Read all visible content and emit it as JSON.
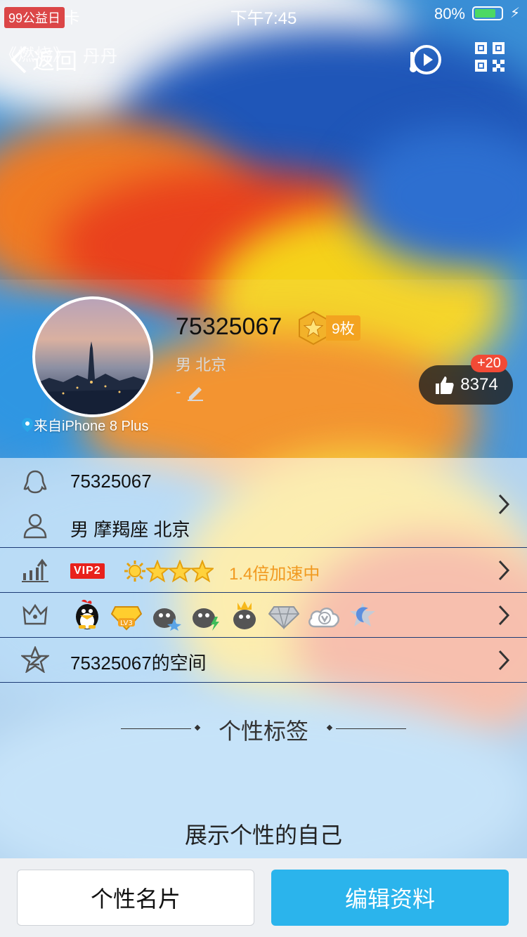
{
  "status_bar": {
    "carrier": "无 SIM 卡",
    "watermark": "99公益日",
    "time": "下午7:45",
    "battery_percent": "80%",
    "battery_level": 0.8
  },
  "nav": {
    "back_label": "返回",
    "song_left": "《燃烧》",
    "song_right": "丹丹",
    "music_icon": "music-play-icon",
    "qr_icon": "qr-code-icon"
  },
  "profile": {
    "qq_number": "75325067",
    "medal_count": "9枚",
    "gender_city": "男  北京",
    "signature": "-",
    "device": "来自iPhone 8 Plus",
    "likes": "8374",
    "likes_increment": "+20"
  },
  "rows": {
    "qq": "75325067",
    "personal": "男 摩羯座 北京",
    "vip_tag": "VIP2",
    "speed": "1.4倍加速中",
    "space": "75325067的空间"
  },
  "tags": {
    "title": "个性标签",
    "text": "展示个性的自己"
  },
  "buttons": {
    "card": "个性名片",
    "edit": "编辑资料"
  },
  "colors": {
    "accent": "#2bb4ec",
    "vip_red": "#e8211c",
    "speed_orange": "#f19a20",
    "like_badge": "#f24a36"
  }
}
